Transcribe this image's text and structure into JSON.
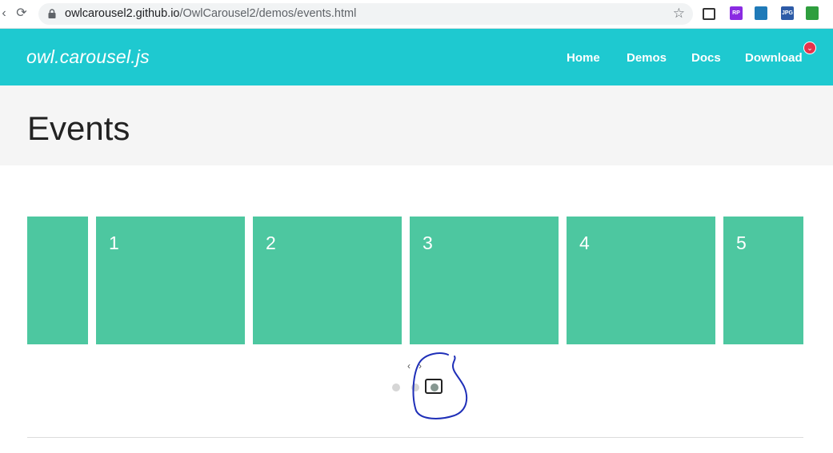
{
  "browser": {
    "url_host": "owlcarousel2.github.io",
    "url_path": "/OwlCarousel2/demos/events.html",
    "extensions": [
      {
        "name": "screenshot-extension",
        "label": "",
        "color": "#333333"
      },
      {
        "name": "rp-extension",
        "label": "RP",
        "color": "#8a2be2"
      },
      {
        "name": "id-card-extension",
        "label": "",
        "color": "#1f7ab8"
      },
      {
        "name": "jpg-extension",
        "label": "JPG",
        "color": "#2d5ba7"
      },
      {
        "name": "flag-extension",
        "label": "",
        "color": "#2e9e3e"
      }
    ]
  },
  "site": {
    "brand": "owl.carousel.js",
    "menu": [
      "Home",
      "Demos",
      "Docs",
      "Download"
    ],
    "accent": "#1ec9d0"
  },
  "page": {
    "title": "Events"
  },
  "carousel": {
    "item_color": "#4dc7a0",
    "items": [
      "",
      "1",
      "2",
      "3",
      "4",
      "5"
    ],
    "nav_prev": "‹",
    "nav_next": "›",
    "dots_count": 3,
    "active_dot": 3
  }
}
